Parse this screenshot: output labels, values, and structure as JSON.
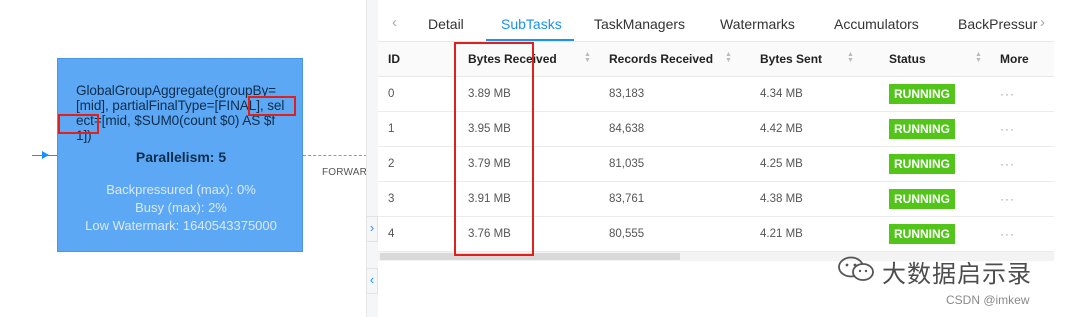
{
  "graph": {
    "node": {
      "description": "GlobalGroupAggregate(groupBy=[mid], partialFinalType=[FINAL], select=[mid, $SUM0(count $0) AS $f1])",
      "parallelism": "Parallelism: 5",
      "backpressured": "Backpressured (max): 0%",
      "busy": "Busy (max): 2%",
      "low_watermark": "Low Watermark: 1640543375000"
    },
    "edge_label": "FORWARD"
  },
  "handles": {
    "expand": "›",
    "collapse": "‹"
  },
  "tabs": {
    "prev": "‹",
    "next": "›",
    "items": [
      "Detail",
      "SubTasks",
      "TaskManagers",
      "Watermarks",
      "Accumulators",
      "BackPressure"
    ],
    "active": "SubTasks"
  },
  "subtasks": {
    "columns": [
      "ID",
      "Bytes Received",
      "Records Received",
      "Bytes Sent",
      "Status",
      "More"
    ],
    "rows": [
      {
        "id": "0",
        "bytes_received": "3.89 MB",
        "records_received": "83,183",
        "bytes_sent": "4.34 MB",
        "status": "RUNNING",
        "more": "···"
      },
      {
        "id": "1",
        "bytes_received": "3.95 MB",
        "records_received": "84,638",
        "bytes_sent": "4.42 MB",
        "status": "RUNNING",
        "more": "···"
      },
      {
        "id": "2",
        "bytes_received": "3.79 MB",
        "records_received": "81,035",
        "bytes_sent": "4.25 MB",
        "status": "RUNNING",
        "more": "···"
      },
      {
        "id": "3",
        "bytes_received": "3.91 MB",
        "records_received": "83,761",
        "bytes_sent": "4.38 MB",
        "status": "RUNNING",
        "more": "···"
      },
      {
        "id": "4",
        "bytes_received": "3.76 MB",
        "records_received": "80,555",
        "bytes_sent": "4.21 MB",
        "status": "RUNNING",
        "more": "···"
      }
    ]
  },
  "watermark": {
    "text": "大数据启示录",
    "csdn": "CSDN @imkew"
  },
  "colors": {
    "accent": "#1890ff",
    "node": "#5da8f5",
    "running": "#52c41a",
    "highlight": "#e0201c"
  }
}
